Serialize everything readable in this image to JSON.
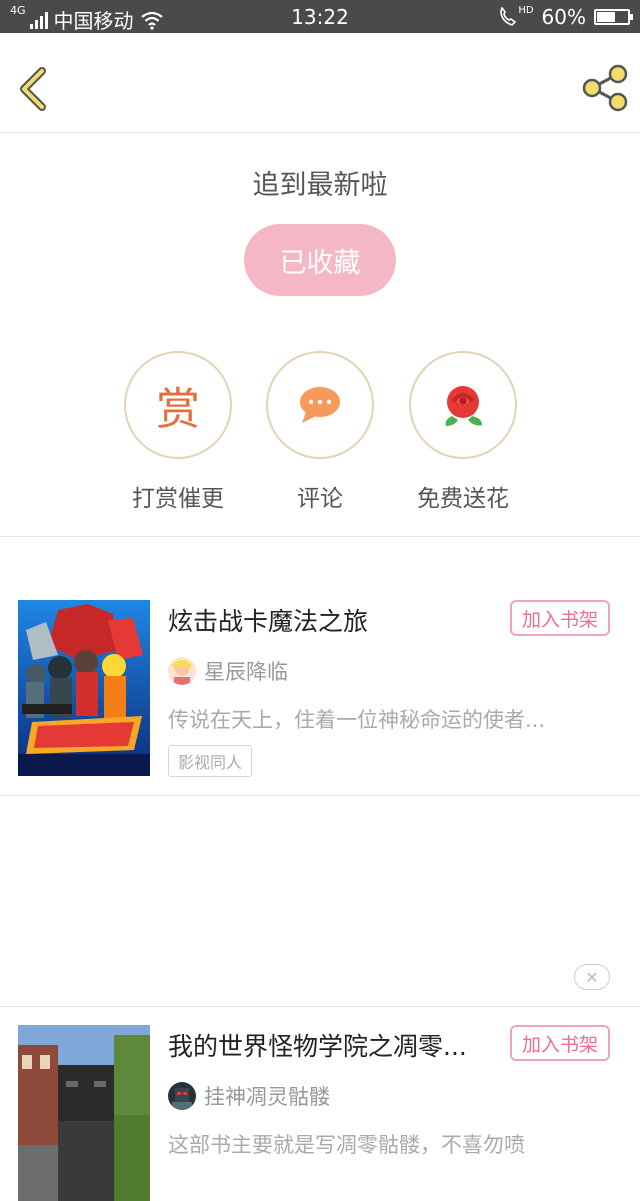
{
  "status_bar": {
    "network": "4G",
    "carrier": "中国移动",
    "time": "13:22",
    "hd": "HD",
    "battery": "60%",
    "battery_level": 0.6
  },
  "nav": {
    "back_icon": "chevron-left-icon",
    "share_icon": "share-icon"
  },
  "main": {
    "caught_up_text": "追到最新啦",
    "favorite_label": "已收藏",
    "actions": [
      {
        "label": "打赏催更",
        "glyph": "赏",
        "icon": "reward-icon"
      },
      {
        "label": "评论",
        "icon": "comment-icon"
      },
      {
        "label": "免费送花",
        "icon": "rose-icon"
      }
    ]
  },
  "recommendations": [
    {
      "title": "炫击战卡魔法之旅",
      "add_label": "加入书架",
      "author": "星辰降临",
      "description": "传说在天上，住着一位神秘命运的使者...",
      "tag": "影视同人"
    },
    {
      "title": "我的世界怪物学院之凋零...",
      "add_label": "加入书架",
      "author": "挂神凋灵骷髅",
      "description": "这部书主要就是写凋零骷髅，不喜勿喷"
    }
  ],
  "ad": {
    "close_glyph": "✕"
  },
  "colors": {
    "accent_pink": "#f5b7c5",
    "add_button": "#ee6d92",
    "icon_gold": "#f3dd6a",
    "reward_orange": "#e2703e",
    "comment_orange": "#f59a5a"
  }
}
